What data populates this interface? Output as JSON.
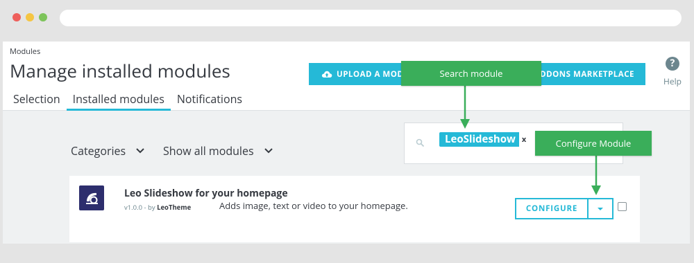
{
  "breadcrumb": "Modules",
  "page_title": "Manage installed modules",
  "tabs": [
    {
      "label": "Selection"
    },
    {
      "label": "Installed modules",
      "active": true
    },
    {
      "label": "Notifications"
    }
  ],
  "toolbar": {
    "upload_label": "UPLOAD A MODULE",
    "marketplace_label": "ADDONS MARKETPLACE",
    "help_label": "Help"
  },
  "filters": {
    "categories_label": "Categories",
    "show_label": "Show all modules"
  },
  "search": {
    "tag": "LeoSlideshow",
    "tag_remove": "x"
  },
  "module": {
    "name": "Leo Slideshow for your homepage",
    "version_prefix": "v1.0.0 - by ",
    "author": "LeoTheme",
    "description": "Adds image, text or video to your homepage.",
    "configure_label": "CONFIGURE"
  },
  "callouts": {
    "search": "Search module",
    "configure": "Configure Module"
  },
  "colors": {
    "accent": "#25b9d7",
    "callout": "#3aae5a"
  },
  "icons": [
    "cloud-upload-icon",
    "help-icon",
    "chevron-down-icon",
    "search-icon",
    "caret-down-icon"
  ]
}
